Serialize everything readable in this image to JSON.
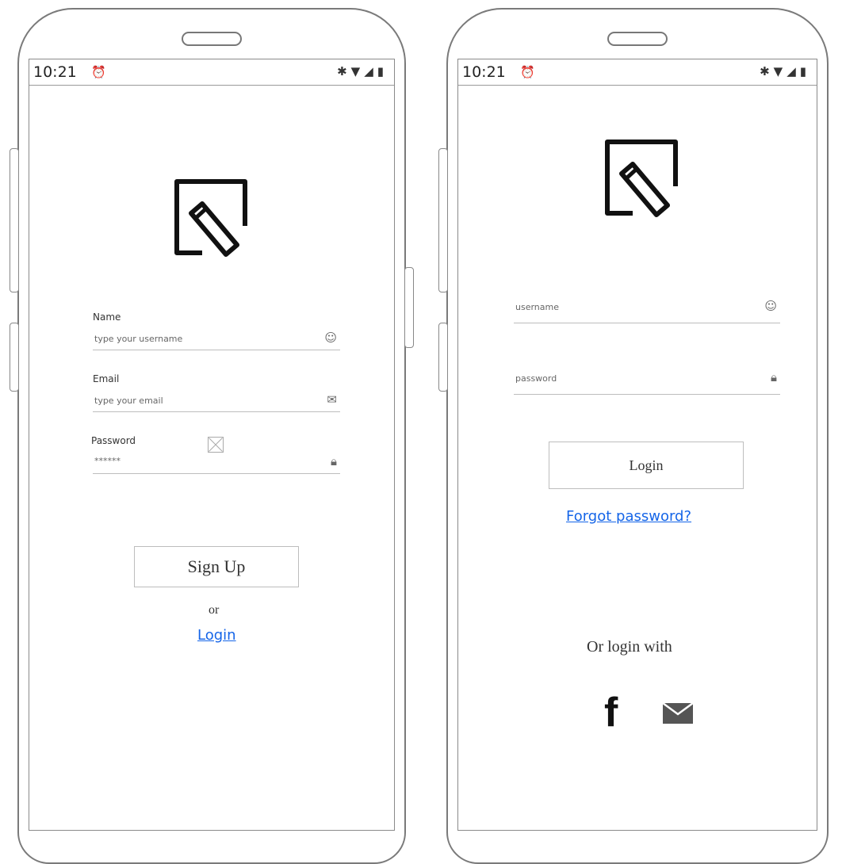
{
  "signup_screen": {
    "status": {
      "time": "10:21"
    },
    "fields": {
      "name": {
        "label": "Name",
        "placeholder": "type your username"
      },
      "email": {
        "label": "Email",
        "placeholder": "type your email"
      },
      "password": {
        "label": "Password",
        "value": "******"
      }
    },
    "signup_button": "Sign Up",
    "or_text": "or",
    "login_link": "Login"
  },
  "login_screen": {
    "status": {
      "time": "10:21"
    },
    "fields": {
      "username": {
        "placeholder": "username"
      },
      "password": {
        "placeholder": "password"
      }
    },
    "login_button": "Login",
    "forgot_link": "Forgot password?",
    "or_login_with": "Or login with",
    "social": [
      "facebook",
      "email"
    ]
  },
  "icons": {
    "alarm": "alarm-icon",
    "bluetooth": "bluetooth-icon",
    "wifi": "wifi-icon",
    "signal": "signal-icon",
    "battery": "battery-icon",
    "user": "user-icon",
    "email": "email-icon",
    "lock": "lock-icon",
    "facebook": "facebook-icon",
    "logo": "edit-logo-icon"
  },
  "colors": {
    "link": "#1565e8",
    "outline": "#7a7a7a"
  }
}
